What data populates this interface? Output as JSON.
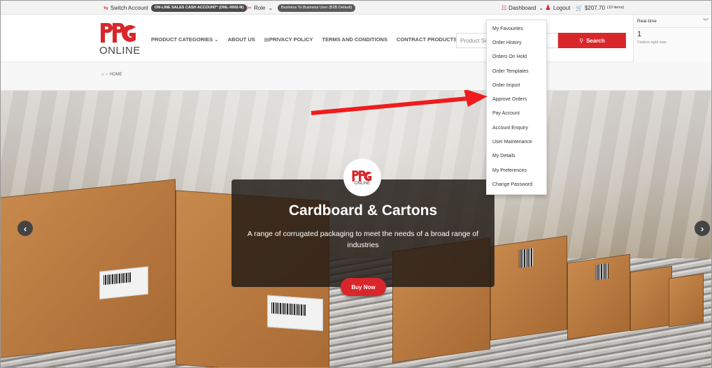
{
  "topbar": {
    "switch_account": "Switch Account",
    "account_pill": "ON-LINE SALES CASH ACCOUNT* (ONL-0002-N)",
    "role_label": "Role",
    "role_pill": "Business To Business User (B2B Default)",
    "dashboard": "Dashboard",
    "logout": "Logout",
    "cart": "$207.70",
    "cart_items": "(10 items)"
  },
  "header": {
    "logo_text": "ONLINE",
    "nav": [
      "PRODUCT CATEGORIES",
      "ABOUT US",
      "PRIVACY POLICY",
      "TERMS AND CONDITIONS",
      "CONTRACT PRODUCTS"
    ],
    "search_placeholder": "Product Se",
    "search_button": "Search"
  },
  "realtime": {
    "title": "Real-time",
    "count": "1",
    "label": "Visitors right now"
  },
  "breadcrumb": {
    "home": "HOME"
  },
  "hero": {
    "badge_text": "ONLINE",
    "title": "Cardboard & Cartons",
    "subtitle": "A range of corrugated packaging to meet the needs of a broad range of industries",
    "button": "Buy Now"
  },
  "dropdown": {
    "items": [
      "My Favourites",
      "Order History",
      "Orders On Hold",
      "Order Templates",
      "Order Import",
      "Approve Orders",
      "Pay Account",
      "Account Enquiry",
      "User Maintenance",
      "My Details",
      "My Preferences",
      "Change Password"
    ]
  },
  "colors": {
    "brand_red": "#d9262b",
    "dark": "#4a4a4a"
  }
}
